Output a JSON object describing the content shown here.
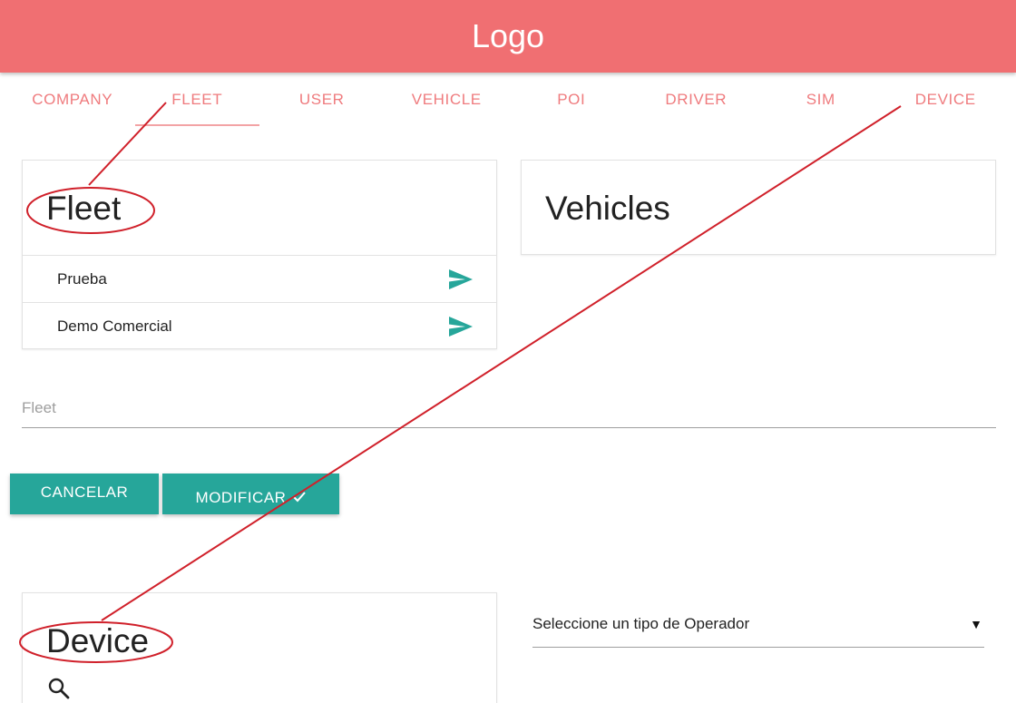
{
  "header": {
    "logo": "Logo",
    "bg_color": "#f06f72"
  },
  "tabs": [
    {
      "label": "COMPANY",
      "active": false
    },
    {
      "label": "FLEET",
      "active": true
    },
    {
      "label": "USER",
      "active": false
    },
    {
      "label": "VEHICLE",
      "active": false
    },
    {
      "label": "POI",
      "active": false
    },
    {
      "label": "DRIVER",
      "active": false
    },
    {
      "label": "SIM",
      "active": false
    },
    {
      "label": "DEVICE",
      "active": false
    }
  ],
  "fleet_card": {
    "title": "Fleet",
    "items": [
      {
        "label": "Prueba",
        "icon": "send-icon"
      },
      {
        "label": "Demo Comercial",
        "icon": "send-icon"
      }
    ]
  },
  "vehicles_card": {
    "title": "Vehicles"
  },
  "fleet_input": {
    "placeholder": "Fleet",
    "value": ""
  },
  "buttons": {
    "cancel": "CANCELAR",
    "modify": "MODIFICAR",
    "modify_icon": "check-icon",
    "color": "#26a69a"
  },
  "device_card": {
    "title": "Device",
    "icon": "search-icon"
  },
  "operator_select": {
    "selected": "Seleccione un tipo de Operador",
    "caret": "▼"
  },
  "colors": {
    "accent": "#26a69a",
    "tab_text": "#ef7b7e",
    "annotation": "#d0202a"
  }
}
